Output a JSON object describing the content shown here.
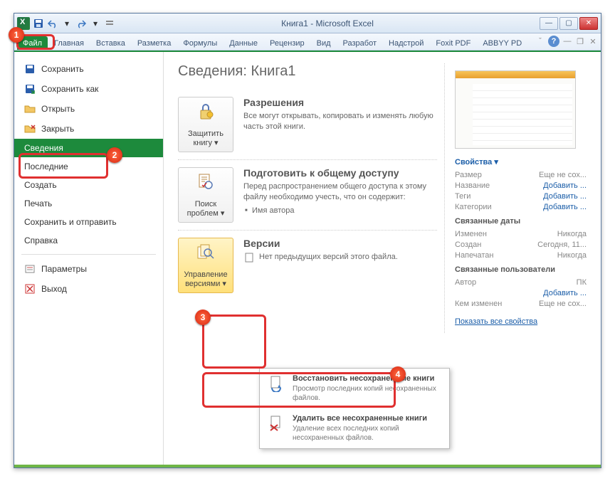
{
  "title": "Книга1  -  Microsoft Excel",
  "qat": {
    "save": "save",
    "undo": "undo",
    "redo": "redo"
  },
  "tabs": [
    "Файл",
    "Главная",
    "Вставка",
    "Разметка",
    "Формулы",
    "Данные",
    "Рецензир",
    "Вид",
    "Разработ",
    "Надстрой",
    "Foxit PDF",
    "ABBYY PD"
  ],
  "sidebar": {
    "save": "Сохранить",
    "saveas": "Сохранить как",
    "open": "Открыть",
    "close": "Закрыть",
    "info": "Сведения",
    "recent": "Последние",
    "new": "Создать",
    "print": "Печать",
    "send": "Сохранить и отправить",
    "help": "Справка",
    "options": "Параметры",
    "exit": "Выход"
  },
  "page": {
    "title": "Сведения: Книга1",
    "perm": {
      "btn": "Защитить книгу",
      "title": "Разрешения",
      "text": "Все могут открывать, копировать и изменять любую часть этой книги."
    },
    "share": {
      "btn": "Поиск проблем",
      "title": "Подготовить к общему доступу",
      "text": "Перед распространением общего доступа к этому файлу необходимо учесть, что он содержит:",
      "bullet": "Имя автора"
    },
    "ver": {
      "btn": "Управление версиями",
      "title": "Версии",
      "text": "Нет предыдущих версий этого файла."
    }
  },
  "dropdown": {
    "recover": {
      "title": "Восстановить несохраненные книги",
      "text": "Просмотр последних копий несохраненных файлов."
    },
    "delete": {
      "title": "Удалить все несохраненные книги",
      "text": "Удаление всех последних копий несохраненных файлов."
    }
  },
  "props": {
    "head": "Свойства",
    "size_k": "Размер",
    "size_v": "Еще не сох...",
    "name_k": "Название",
    "name_v": "Добавить ...",
    "tags_k": "Теги",
    "tags_v": "Добавить ...",
    "cat_k": "Категории",
    "cat_v": "Добавить ...",
    "dates": "Связанные даты",
    "mod_k": "Изменен",
    "mod_v": "Никогда",
    "cre_k": "Создан",
    "cre_v": "Сегодня, 11...",
    "prn_k": "Напечатан",
    "prn_v": "Никогда",
    "users": "Связанные пользователи",
    "auth_k": "Автор",
    "auth_v": "ПК",
    "authadd": "Добавить ...",
    "modby_k": "Кем изменен",
    "modby_v": "Еще не сох...",
    "showall": "Показать все свойства"
  }
}
